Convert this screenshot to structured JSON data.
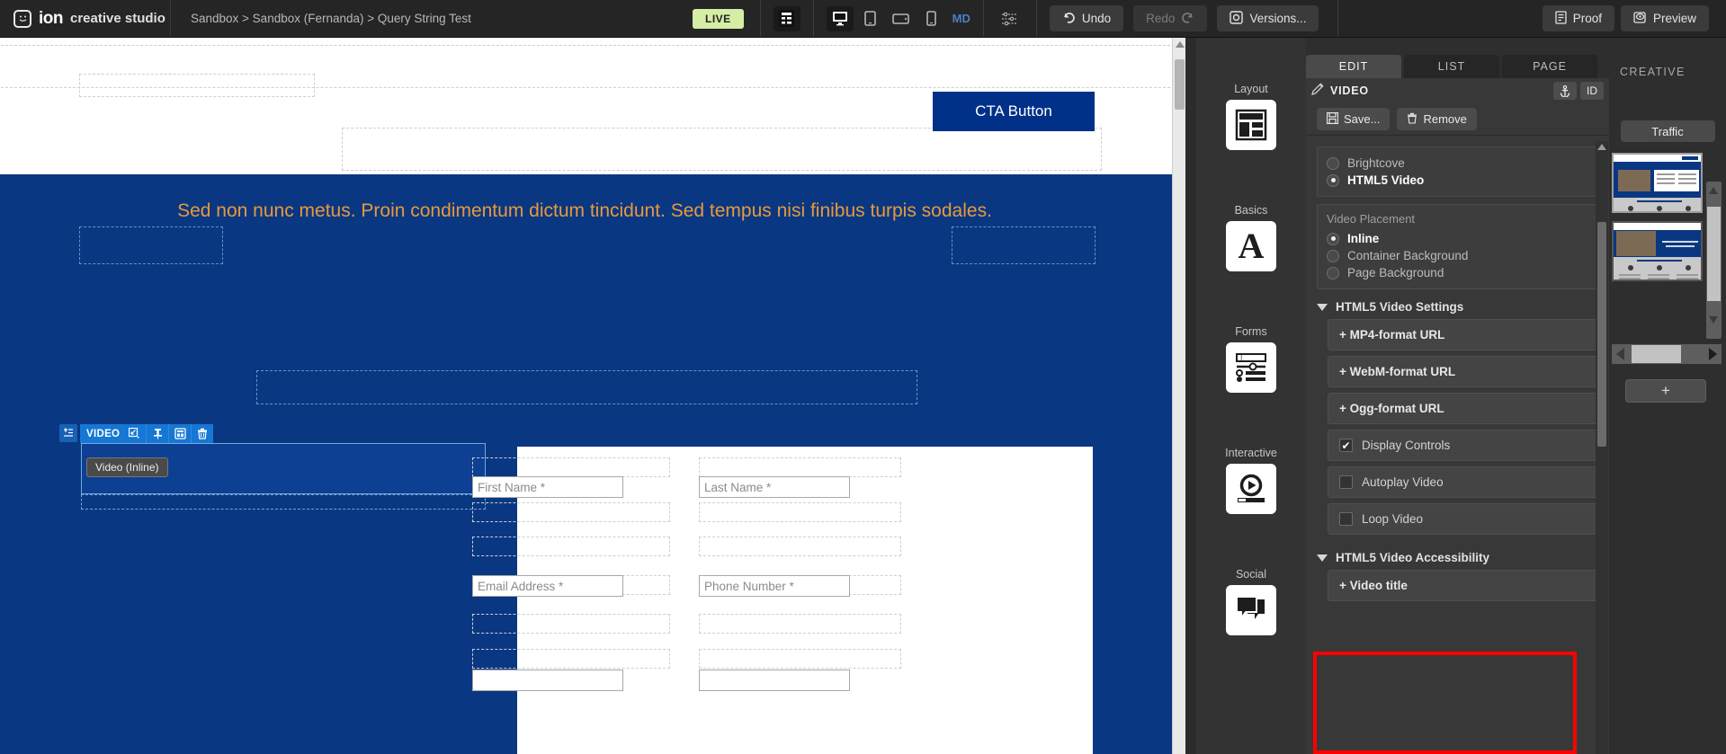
{
  "app": {
    "brand_name": "ion",
    "brand_suffix": "creative studio",
    "brand_icon": "ion-logo-icon"
  },
  "breadcrumb": {
    "text": "Sandbox > Sandbox (Fernanda) > Query String Test"
  },
  "toolbar": {
    "live_badge": "LIVE",
    "grid_icon": "layout-grid-icon",
    "devices": [
      {
        "name": "desktop",
        "icon": "desktop-icon",
        "selected": true
      },
      {
        "name": "tablet-portrait",
        "icon": "tablet-portrait-icon",
        "selected": false
      },
      {
        "name": "tablet-landscape",
        "icon": "tablet-landscape-icon",
        "selected": false
      },
      {
        "name": "mobile",
        "icon": "mobile-icon",
        "selected": false
      }
    ],
    "breakpoint_label": "MD",
    "settings_icon": "sliders-icon",
    "undo_label": "Undo",
    "undo_icon": "undo-arrow-icon",
    "redo_label": "Redo",
    "redo_icon": "redo-arrow-icon",
    "versions_label": "Versions...",
    "versions_icon": "versions-icon",
    "proof_label": "Proof",
    "proof_icon": "document-icon",
    "preview_label": "Preview",
    "preview_icon": "eye-icon"
  },
  "canvas": {
    "cta_button_label": "CTA Button",
    "headline": "Sed non nunc metus. Proin condimentum dictum tincidunt. Sed tempus nisi finibus turpis sodales.",
    "element_toolbar": {
      "move_icon": "move-up-icon",
      "label": "VIDEO",
      "resize_icon": "resize-icon",
      "pin_icon": "pin-icon",
      "duplicate_icon": "layout-duplicate-icon",
      "delete_icon": "trash-icon"
    },
    "tooltip": "Video (Inline)",
    "form_fields": [
      {
        "placeholder": "First Name *"
      },
      {
        "placeholder": "Last Name *"
      },
      {
        "placeholder": "Email Address *"
      },
      {
        "placeholder": "Phone Number *"
      }
    ]
  },
  "tool_rail": [
    {
      "label": "Layout",
      "icon": "layout-icon"
    },
    {
      "label": "Basics",
      "icon": "typography-a-icon"
    },
    {
      "label": "Forms",
      "icon": "forms-icon"
    },
    {
      "label": "Interactive",
      "icon": "play-media-icon"
    },
    {
      "label": "Social",
      "icon": "chat-bubbles-icon"
    }
  ],
  "panel": {
    "tabs": [
      {
        "label": "EDIT",
        "active": true
      },
      {
        "label": "LIST",
        "active": false
      },
      {
        "label": "PAGE",
        "active": false
      }
    ],
    "creative_label": "CREATIVE",
    "header": {
      "edit_icon": "pencil-icon",
      "title": "VIDEO",
      "anchor_icon": "anchor-icon",
      "id_label": "ID"
    },
    "actions": {
      "save_label": "Save...",
      "save_icon": "floppy-disk-icon",
      "remove_label": "Remove",
      "remove_icon": "trash-icon"
    },
    "video_type": {
      "options": [
        {
          "label": "Brightcove",
          "selected": false
        },
        {
          "label": "HTML5 Video",
          "selected": true
        }
      ]
    },
    "video_placement": {
      "caption": "Video Placement",
      "options": [
        {
          "label": "Inline",
          "selected": true
        },
        {
          "label": "Container Background",
          "selected": false
        },
        {
          "label": "Page Background",
          "selected": false
        }
      ]
    },
    "video_settings": {
      "title": "HTML5 Video Settings",
      "rows": [
        {
          "label": "+ MP4-format URL"
        },
        {
          "label": "+ WebM-format URL"
        },
        {
          "label": "+ Ogg-format URL"
        }
      ],
      "checkboxes": [
        {
          "label": "Display Controls",
          "checked": true
        },
        {
          "label": "Autoplay Video",
          "checked": false
        },
        {
          "label": "Loop Video",
          "checked": false
        }
      ]
    },
    "video_accessibility": {
      "title": "HTML5 Video Accessibility",
      "row_label": "+ Video title",
      "highlight_color": "#ff0000"
    }
  },
  "thumbnails": {
    "traffic_label": "Traffic",
    "add_label": "+"
  }
}
